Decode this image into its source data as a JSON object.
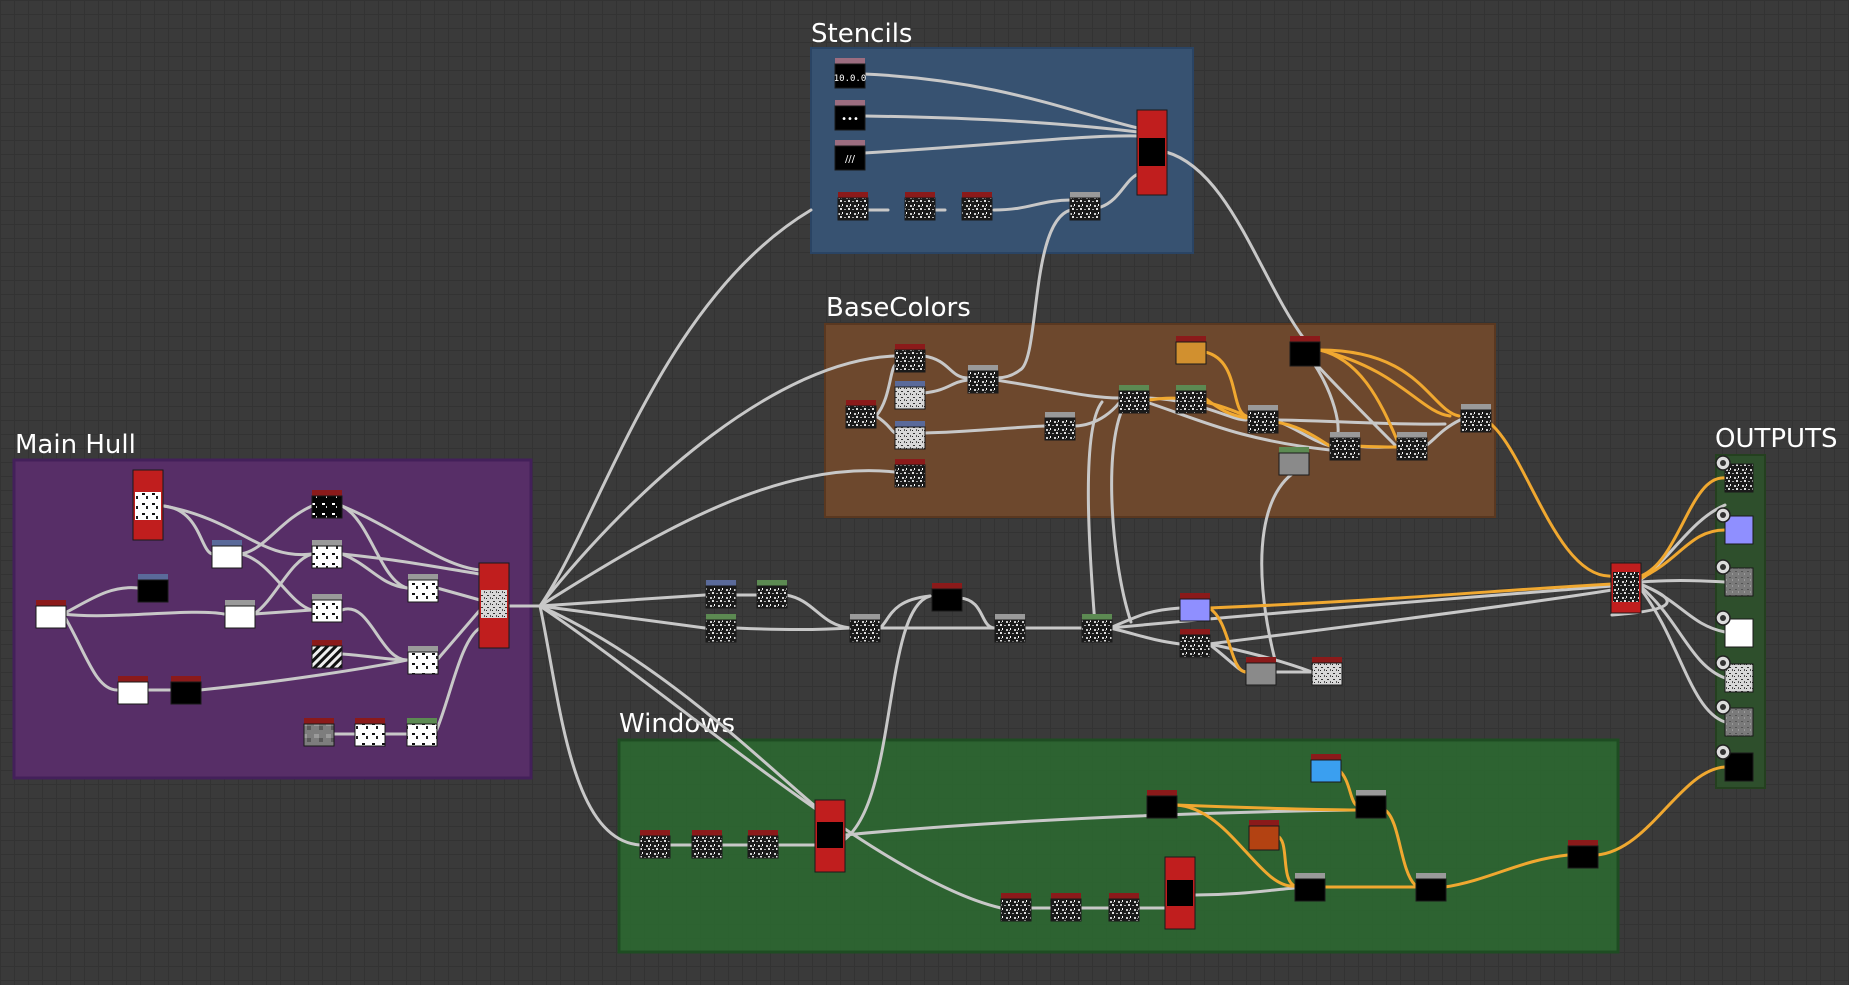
{
  "frames": [
    {
      "id": "stencils",
      "title": "Stencils",
      "color": "#375578"
    },
    {
      "id": "basecolors",
      "title": "BaseColors",
      "color": "#734a2c"
    },
    {
      "id": "mainhull",
      "title": "Main Hull",
      "color": "#5b2e6d"
    },
    {
      "id": "windows",
      "title": "Windows",
      "color": "#2c6530"
    },
    {
      "id": "outputs",
      "title": "OUTPUTS",
      "color": "#2e4f2c"
    }
  ],
  "stencil_labels": {
    "s1": "10.0.0",
    "s2": "•••",
    "s3": "///"
  },
  "colors": {
    "canvas": "#3a3a3a",
    "wire": "#c8c8c8",
    "wire_highlight": "#f0a830",
    "node_header": "#8b1a1a",
    "blend_node": "#c01e1e",
    "swatch_orange": "#d1902f",
    "swatch_blue": "#3a9ff0",
    "swatch_rust": "#b34212",
    "swatch_lavender": "#8f8fff"
  }
}
